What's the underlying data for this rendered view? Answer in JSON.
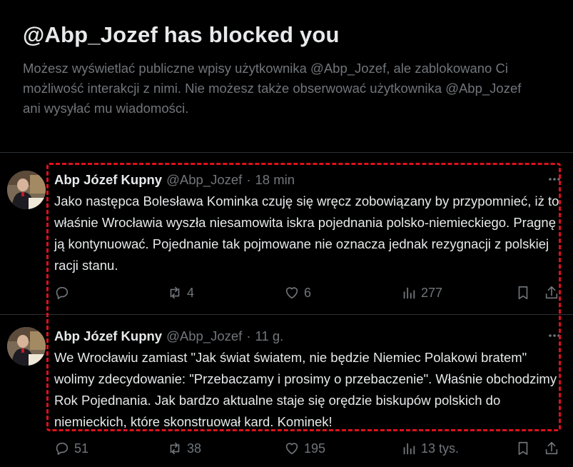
{
  "blocked_notice": {
    "title": "@Abp_Jozef has blocked you",
    "description": "Możesz wyświetlać publiczne wpisy użytkownika @Abp_Jozef, ale zablokowano Ci możliwość interakcji z nimi. Nie możesz także obserwować użytkownika @Abp_Jozef ani wysyłać mu wiadomości."
  },
  "tweets": [
    {
      "author_name": "Abp Józef Kupny",
      "handle": "@Abp_Jozef",
      "separator": "·",
      "time": "18 min",
      "text": "Jako następca Bolesława Kominka czuję się wręcz zobowiązany by przypomnieć, iż to właśnie Wrocławia wyszła niesamowita iskra pojednania polsko-niemieckiego. Pragnę ją kontynuować. Pojednanie tak pojmowane nie oznacza jednak rezygnacji z polskiej racji stanu.",
      "replies": "",
      "retweets": "4",
      "likes": "6",
      "views": "277"
    },
    {
      "author_name": "Abp Józef Kupny",
      "handle": "@Abp_Jozef",
      "separator": "·",
      "time": "11 g.",
      "text": "We Wrocławiu zamiast \"Jak świat światem, nie będzie Niemiec Polakowi bratem\" wolimy zdecydowanie: \"Przebaczamy i prosimy o przebaczenie\". Właśnie obchodzimy Rok Pojednania. Jak bardzo aktualne staje się orędzie biskupów polskich do niemieckich, które skonstruował kard. Kominek!",
      "replies": "51",
      "retweets": "38",
      "likes": "195",
      "views": "13 tys."
    }
  ],
  "icons": {
    "more": "more-icon",
    "reply": "reply-icon",
    "retweet": "retweet-icon",
    "like": "heart-icon",
    "views": "views-icon",
    "bookmark": "bookmark-icon",
    "share": "share-icon"
  },
  "colors": {
    "background": "#000000",
    "text": "#e7e9ea",
    "muted": "#71767b",
    "divider": "#2f3336",
    "highlight": "#e0101c"
  }
}
